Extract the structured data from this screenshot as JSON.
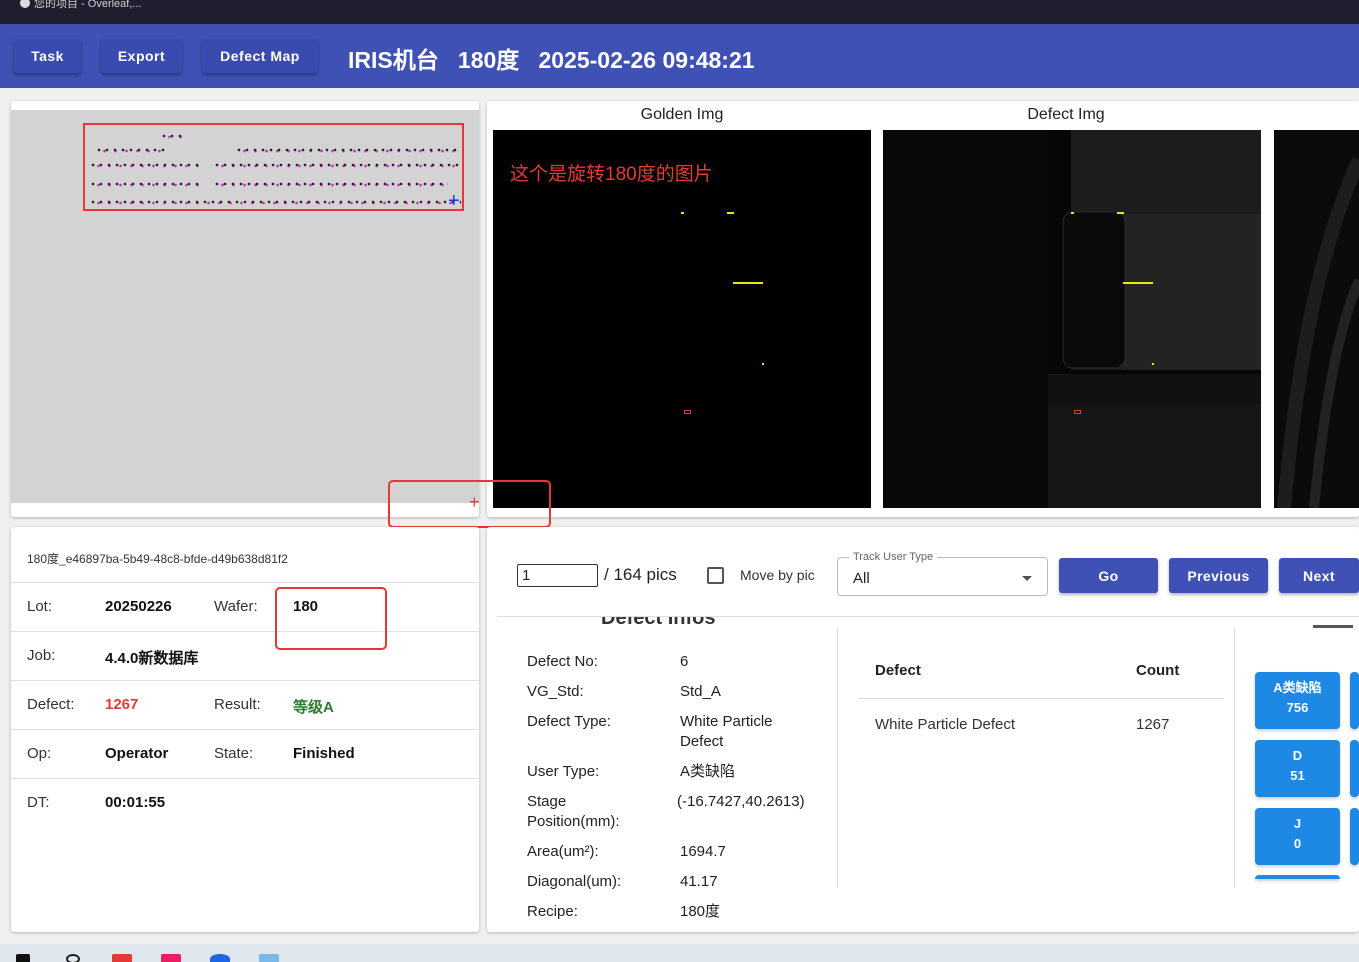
{
  "browser": {
    "tab_title": "您的项目 - Overleaf,..."
  },
  "header": {
    "task_label": "Task",
    "export_label": "Export",
    "defect_map_label": "Defect Map",
    "title": "IRIS机台   180度   2025-02-26 09:48:21",
    "color": "#3f51b5"
  },
  "images": {
    "golden_label": "Golden Img",
    "defect_label": "Defect Img",
    "annotation": "这个是旋转180度的图片"
  },
  "info": {
    "file_id": "180度_e46897ba-5b49-48c8-bfde-d49b638d81f2",
    "lot_label": "Lot:",
    "lot": "20250226",
    "wafer_label": "Wafer:",
    "wafer": "180",
    "job_label": "Job:",
    "job": "4.4.0新数据库",
    "defect_label": "Defect:",
    "defect": "1267",
    "result_label": "Result:",
    "result": "等级A",
    "op_label": "Op:",
    "op": "Operator",
    "state_label": "State:",
    "state": "Finished",
    "dt_label": "DT:",
    "dt": "00:01:55",
    "defect_color": "#e53935",
    "result_color": "#2e7d32"
  },
  "nav": {
    "page_value": "1",
    "page_total": "/ 164 pics",
    "move_by_pic_label": "Move by pic",
    "move_by_pic_checked": false,
    "track_user_type_label": "Track User Type",
    "track_user_type_value": "All",
    "go_label": "Go",
    "previous_label": "Previous",
    "next_label": "Next"
  },
  "defect_info": {
    "heading": "Defect Infos",
    "rows": [
      {
        "label": "Defect No:",
        "value": "6"
      },
      {
        "label": "VG_Std:",
        "value": "Std_A"
      },
      {
        "label": "Defect Type:",
        "value": "White Particle Defect"
      },
      {
        "label": "User Type:",
        "value": "A类缺陷"
      },
      {
        "label": "Stage Position(mm):",
        "value": "(-16.7427,40.2613)"
      },
      {
        "label": "Area(um²):",
        "value": "1694.7"
      },
      {
        "label": "Diagonal(um):",
        "value": "41.17"
      },
      {
        "label": "Recipe:",
        "value": "180度"
      }
    ]
  },
  "defect_table": {
    "col_defect": "Defect",
    "col_count": "Count",
    "rows": [
      {
        "defect": "White Particle Defect",
        "count": "1267"
      }
    ]
  },
  "classify_tiles": [
    {
      "name": "A类缺陷",
      "count": "756"
    },
    {
      "name": "D",
      "count": "51"
    },
    {
      "name": "J",
      "count": "0"
    }
  ]
}
